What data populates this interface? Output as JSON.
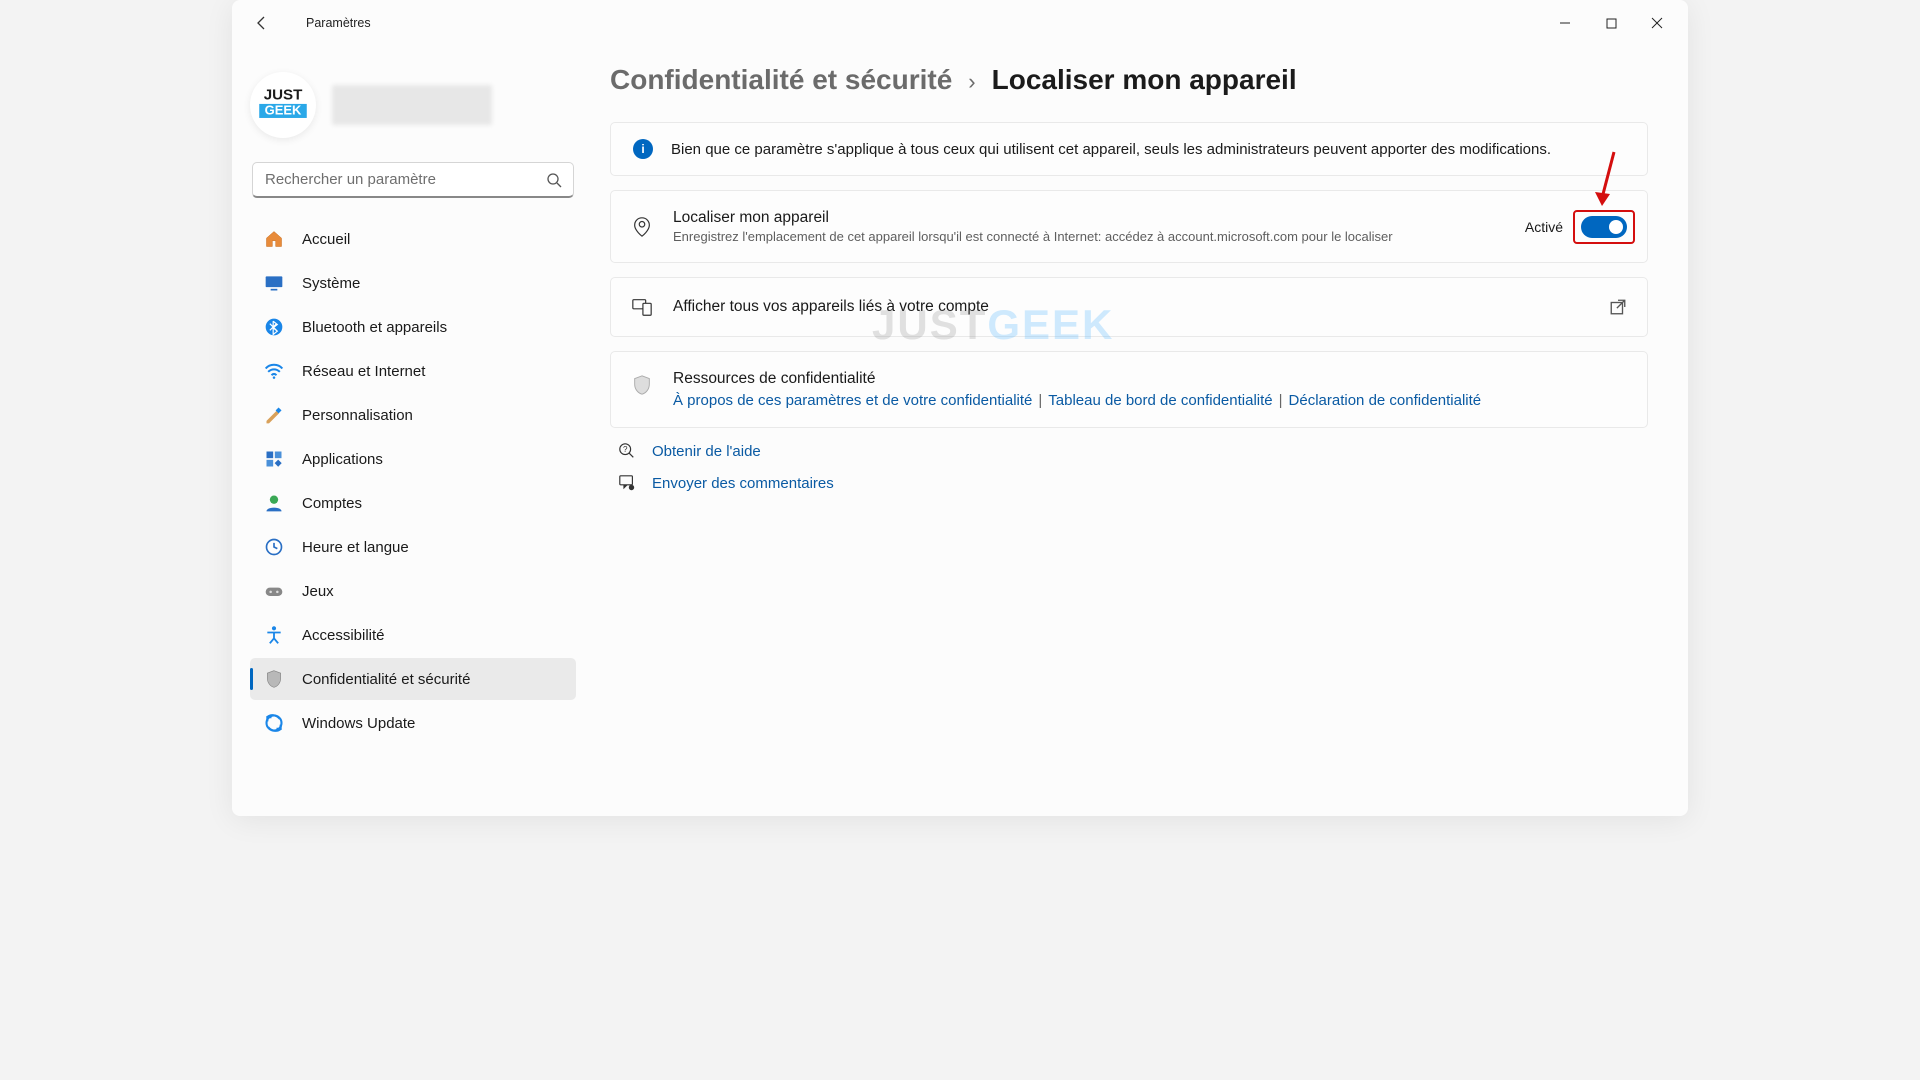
{
  "window": {
    "title": "Paramètres"
  },
  "search": {
    "placeholder": "Rechercher un paramètre"
  },
  "sidebar": {
    "items": [
      {
        "id": "home",
        "label": "Accueil"
      },
      {
        "id": "system",
        "label": "Système"
      },
      {
        "id": "bluetooth",
        "label": "Bluetooth et appareils"
      },
      {
        "id": "network",
        "label": "Réseau et Internet"
      },
      {
        "id": "personalization",
        "label": "Personnalisation"
      },
      {
        "id": "apps",
        "label": "Applications"
      },
      {
        "id": "accounts",
        "label": "Comptes"
      },
      {
        "id": "time",
        "label": "Heure et langue"
      },
      {
        "id": "gaming",
        "label": "Jeux"
      },
      {
        "id": "accessibility",
        "label": "Accessibilité"
      },
      {
        "id": "privacy",
        "label": "Confidentialité et sécurité"
      },
      {
        "id": "update",
        "label": "Windows Update"
      }
    ],
    "selected": "privacy"
  },
  "breadcrumb": {
    "parent": "Confidentialité et sécurité",
    "current": "Localiser mon appareil"
  },
  "info_banner": "Bien que ce paramètre s'applique à tous ceux qui utilisent cet appareil, seuls les administrateurs peuvent apporter des modifications.",
  "find_device": {
    "title": "Localiser mon appareil",
    "desc": "Enregistrez l'emplacement de cet appareil lorsqu'il est connecté à Internet: accédez à account.microsoft.com pour le localiser",
    "state_label": "Activé",
    "state": true
  },
  "linked_devices": {
    "label": "Afficher tous vos appareils liés à votre compte"
  },
  "resources": {
    "title": "Ressources de confidentialité",
    "links": [
      "À propos de ces paramètres et de votre confidentialité",
      "Tableau de bord de confidentialité",
      "Déclaration de confidentialité"
    ]
  },
  "footer": {
    "help": "Obtenir de l'aide",
    "feedback": "Envoyer des commentaires"
  },
  "watermark": {
    "a": "JUST",
    "b": "GEEK"
  },
  "annotations": {
    "toggle_highlighted": true
  }
}
